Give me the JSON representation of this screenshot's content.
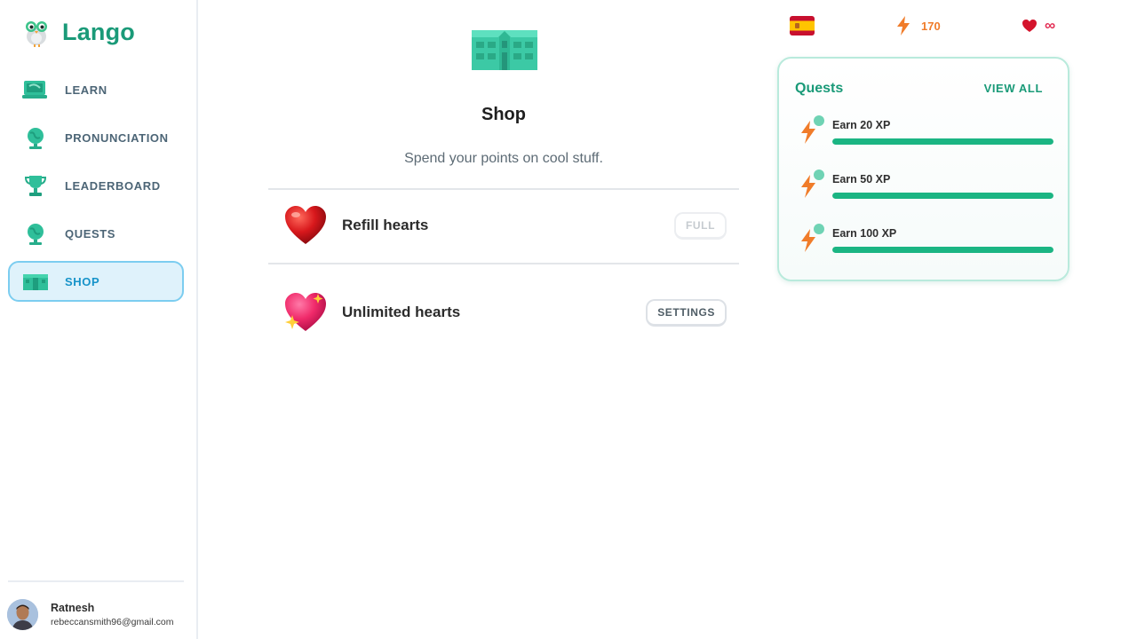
{
  "app": {
    "name": "Lango"
  },
  "sidebar": {
    "items": [
      {
        "label": "LEARN",
        "icon": "learn-icon",
        "active": false
      },
      {
        "label": "PRONUNCIATION",
        "icon": "globe-icon",
        "active": false
      },
      {
        "label": "LEADERBOARD",
        "icon": "trophy-icon",
        "active": false
      },
      {
        "label": "QUESTS",
        "icon": "globe-icon",
        "active": false
      },
      {
        "label": "SHOP",
        "icon": "shop-icon",
        "active": true
      }
    ]
  },
  "user": {
    "name": "Ratnesh",
    "email": "rebeccansmith96@gmail.com"
  },
  "main": {
    "title": "Shop",
    "subtitle": "Spend your points on cool stuff.",
    "rows": [
      {
        "label": "Refill hearts",
        "icon": "heart-icon",
        "button": "FULL",
        "button_disabled": true
      },
      {
        "label": "Unlimited hearts",
        "icon": "sparkle-heart-icon",
        "button": "SETTINGS",
        "button_disabled": false
      }
    ]
  },
  "stats": {
    "language_flag": "spain-flag-icon",
    "xp": "170",
    "hearts": "∞"
  },
  "quests": {
    "title": "Quests",
    "view_all": "VIEW ALL",
    "items": [
      {
        "label": "Earn 20 XP",
        "progress": 1.0
      },
      {
        "label": "Earn 50 XP",
        "progress": 1.0
      },
      {
        "label": "Earn 100 XP",
        "progress": 1.0
      }
    ]
  },
  "colors": {
    "brand": "#1a9a78",
    "active_nav_bg": "#dff2fb",
    "active_nav_border": "#7ccdf0",
    "xp": "#f07c2a",
    "hearts": "#e32d54",
    "progress": "#1bb583"
  }
}
